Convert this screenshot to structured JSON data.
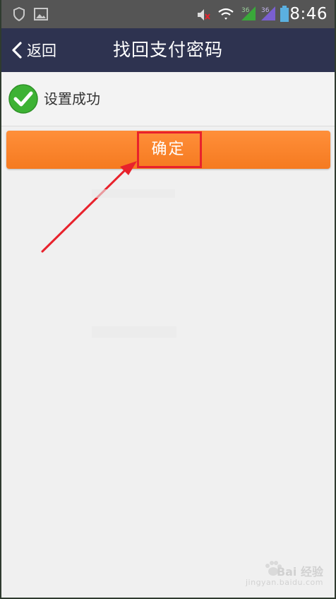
{
  "status_bar": {
    "time": "8:46",
    "icons": [
      "shield-icon",
      "image-icon",
      "mute-icon",
      "wifi-icon",
      "signal-icon",
      "signal-icon-2",
      "battery-icon"
    ]
  },
  "header": {
    "back_label": "返回",
    "title": "找回支付密码"
  },
  "message": {
    "text": "设置成功",
    "icon": "check-circle-icon"
  },
  "confirm": {
    "label": "确定"
  },
  "watermark": {
    "brand": "Bai 经验",
    "url": "jingyan.baidu.com"
  },
  "colors": {
    "header_bg": "#2e3350",
    "button": "#f57a20",
    "check": "#3db234",
    "highlight": "#e8222c"
  }
}
